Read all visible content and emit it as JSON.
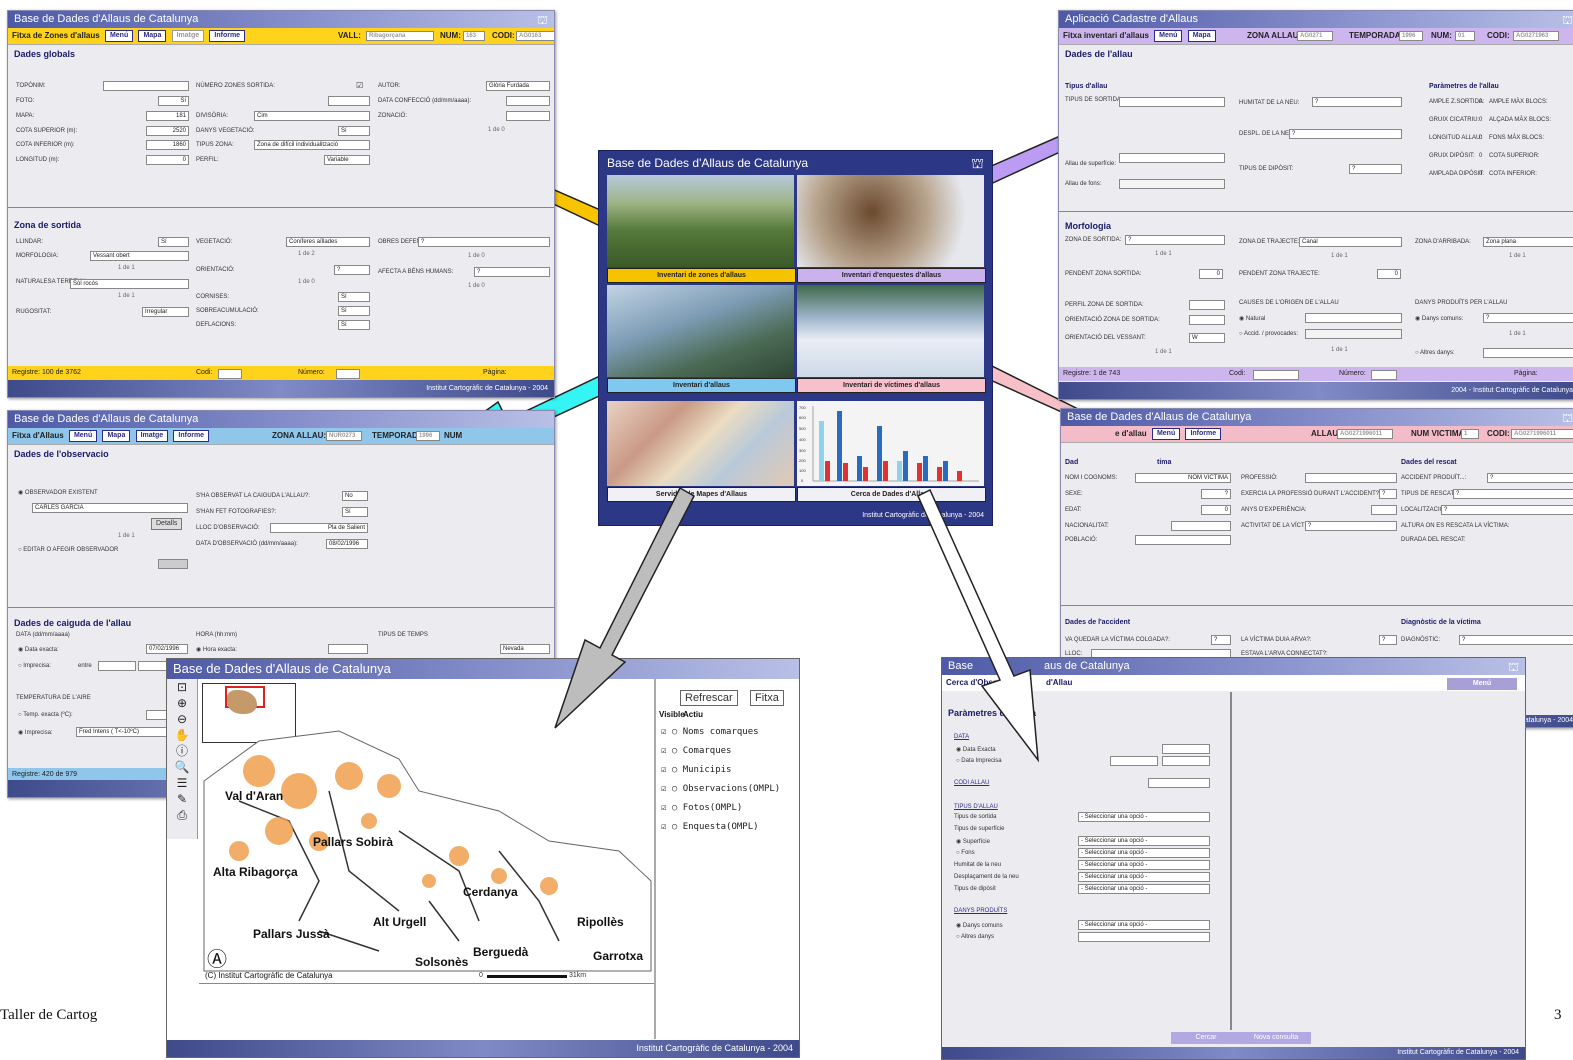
{
  "app_title": "Base de Dades d'Allaus de Catalunya",
  "footer_credit": "Institut Cartogràfic de Catalunya - 2004",
  "footer_credit_alt": "2004 - Institut Cartogràfic de Catalunya",
  "footer_partial": "Catalunya - 2004",
  "slide_footer_left": "Taller de Cartog",
  "slide_page_partial": "3",
  "zones": {
    "form_title": "Fitxa de Zones d'allaus",
    "buttons": [
      "Menú",
      "Mapa",
      "Imatge",
      "Informe"
    ],
    "vall_label": "VALL:",
    "vall_value": "Ribagorçana",
    "num_label": "NUM:",
    "num_value": "163",
    "codi_label": "CODI:",
    "codi_value": "AG0163",
    "section_global": "Dades globals",
    "section_sortida": "Zona de sortida",
    "toponim": "TOPÒNIM:",
    "foto": "FOTO:",
    "foto_v": "Sí",
    "mapa": "MAPA:",
    "mapa_v": "181",
    "cota_sup": "COTA SUPERIOR (m):",
    "cota_sup_v": "2520",
    "cota_inf": "COTA INFERIOR (m):",
    "cota_inf_v": "1860",
    "longitud": "LONGITUD (m):",
    "longitud_v": "0",
    "num_zones": "NÚMERO ZONES SORTIDA:",
    "divisoria": "DIVISÒRIA:",
    "divisoria_v": "Cim",
    "danys": "DANYS VEGETACIÓ:",
    "danys_v": "Sí",
    "tipus_zona": "TIPUS ZONA:",
    "tipus_zona_v": "Zona de difícil individualització",
    "perfil": "PERFIL:",
    "perfil_v": "Variable",
    "autor": "AUTOR:",
    "autor_v": "Glòria Furdada",
    "data": "DATA CONFECCIÓ (dd/mm/aaaa):",
    "zonacio": "ZONACIÓ:",
    "llindar": "LLINDAR:",
    "llindar_v": "Sí",
    "morfologia": "MORFOLOGIA:",
    "morfologia_v": "Vessant obert",
    "naturalesa": "NATURALESA TERRENY:",
    "naturalesa_v": "Sòl rocós",
    "rugositat": "RUGOSITAT:",
    "rugositat_v": "Irregular",
    "vegetacio": "VEGETACIÓ:",
    "vegetacio_v": "Coníferes aïllades",
    "orientacio": "ORIENTACIÓ:",
    "orientacio_v": "?",
    "cornises": "CORNISES:",
    "cornises_v": "Sí",
    "sobreacum": "SOBREACUMULACIÓ:",
    "sobreacum_v": "Sí",
    "deflacions": "DEFLACIONS:",
    "deflacions_v": "Sí",
    "obres": "OBRES DEFENSA:",
    "obres_v": "?",
    "afecta": "AFECTA A BÉNS HUMANS:",
    "afecta_v": "?",
    "nav1": "1 de 1",
    "nav2": "1 de 2",
    "nav0": "1 de 0",
    "registre": "Registre:",
    "registre_v": "100 de 3762",
    "codi": "Codi:",
    "numero": "Número:",
    "pagina": "Pàgina:"
  },
  "cadastre": {
    "window_title": "Aplicació Cadastre d'Allaus",
    "form_title": "Fitxa inventari d'allaus",
    "buttons": [
      "Menú",
      "Mapa"
    ],
    "zona_label": "ZONA ALLAU:",
    "zona_value": "AG0271",
    "temporada_label": "TEMPORADA:",
    "temporada_value": "1996",
    "num_label": "NUM:",
    "num_value": "01",
    "codi_label": "CODI:",
    "codi_value": "AG0271963",
    "section_dades": "Dades de l'allau",
    "tipus": "Tipus d'allau",
    "tipus_sortida": "TIPUS DE SORTIDA:",
    "humitat": "HUMITAT DE LA NEU:",
    "humitat_v": "?",
    "despl": "DESPL. DE LA NEU:",
    "despl_v": "?",
    "tipus_diposit": "TIPUS DE DIPÒSIT:",
    "tipus_diposit_v": "?",
    "allau_sup": "Allau de superfície:",
    "allau_fons": "Allau de fons:",
    "params": "Paràmetres de l'allau",
    "ample_sortida": "AMPLE Z.SORTIDA:",
    "ample_blocs": "AMPLE MÀX BLOCS:",
    "gruix_cicatriu": "GRUIX CICATRIU:",
    "alcada_blocs": "ALÇADA MÀX BLOCS:",
    "longitud_allau": "LONGITUD ALLAU:",
    "fons_blocs": "FONS MÀX BLOCS:",
    "gruix_diposit": "GRUIX DIPÒSIT:",
    "cota_sup": "COTA SUPERIOR:",
    "amplada_diposit": "AMPLADA DIPÒSIT:",
    "cota_inf": "COTA INFERIOR:",
    "zero": "0",
    "section_morf": "Morfologia",
    "zona_sortida": "ZONA DE SORTIDA:",
    "zona_sortida_v": "?",
    "zona_trajecte": "ZONA DE TRAJECTE:",
    "zona_trajecte_v": "Canal",
    "zona_arribada": "ZONA D'ARRIBADA:",
    "zona_arribada_v": "Zona plana",
    "pendent_sortida": "PENDENT ZONA SORTIDA:",
    "pendent_trajecte": "PENDENT ZONA TRAJECTE:",
    "perfil_sortida": "PERFIL ZONA DE SORTIDA:",
    "orient_sortida": "ORIENTACIÓ ZONA DE SORTIDA:",
    "orient_vessant": "ORIENTACIÓ DEL VESSANT:",
    "orient_vessant_v": "W",
    "causes": "CAUSES DE L'ORIGEN DE L'ALLAU",
    "natural": "Natural",
    "accid": "Accid. / provocades:",
    "danys": "DANYS PRODUÏTS PER L'ALLAU",
    "danys_comuns": "Danys comuns:",
    "altres_danys": "Altres danys:",
    "nav": "1 de 1",
    "registre": "Registre:",
    "registre_v": "1 de 743",
    "codi": "Codi:",
    "numero": "Número:",
    "pagina": "Pàgina:"
  },
  "portal": {
    "tiles": [
      "Inventari de zones d'allaus",
      "Inventari d'enquestes d'allaus",
      "Inventari d'allaus",
      "Inventari de víctimes d'allaus",
      "Servidor de Mapes d'Allaus",
      "Cerca de Dades d'Allaus"
    ],
    "chart_axis": [
      "700",
      "600",
      "500",
      "400",
      "300",
      "200",
      "100",
      "0"
    ]
  },
  "observ": {
    "form_title": "Fitxa d'Allaus",
    "buttons": [
      "Menú",
      "Mapa",
      "Imatge",
      "Informe"
    ],
    "zona_label": "ZONA ALLAU:",
    "zona_value": "NUR0273",
    "temporada_label": "TEMPORADA:",
    "temporada_value": "1996",
    "num_label": "NUM",
    "section_obs": "Dades de l'observacio",
    "obs_existent": "OBSERVADOR EXISTENT",
    "obs_value": "CARLES GARCIA",
    "detalls": "Detalls",
    "editar": "EDITAR O AFEGIR OBSERVADOR",
    "nav": "1 de 1",
    "caiguda": "S'HA OBSERVAT LA CAIGUDA L'ALLAU?:",
    "caiguda_v": "No",
    "foto": "S'HAN FET FOTOGRAFIES?:",
    "foto_v": "Sí",
    "lloc": "LLOC D'OBSERVACIÓ:",
    "lloc_v": "Pla de Salient",
    "data": "DATA D'OBSERVACIÓ (dd/mm/aaaa):",
    "data_v": "08/02/1996",
    "section_caig": "Dades de caiguda de l'allau",
    "data_c": "DATA (dd/mm/aaaa)",
    "data_exacta": "Data exacta:",
    "data_exacta_v": "07/02/1996",
    "imprecisa": "Imprecisa:",
    "entre": "entre",
    "hora": "HORA (hh:mm)",
    "hora_exacta": "Hora exacta:",
    "temps": "TIPUS DE TEMPS",
    "temps_v": "Nevada",
    "temp": "TEMPERATURA DE L'AIRE",
    "temp_exacta": "Temp. exacta (ºC):",
    "temp_imprecisa": "Imprecisa:",
    "temp_v": "Fred Intens ( T<-10ºC)",
    "registre": "Registre:",
    "registre_v": "420 de 979"
  },
  "victimes": {
    "form_title": "Fitxa de víctimes d'allau",
    "form_title_visible": "e d'allau",
    "buttons": [
      "Menú",
      "Informe"
    ],
    "allau_label": "ALLAU:",
    "allau_value": "AG0271996011",
    "num_label": "NUM VICTIMA:",
    "num_value": "1",
    "codi_label": "CODI:",
    "codi_value": "AG0271996011",
    "dades_vic": "Dades de la víctima",
    "dades_vic_visible": "Dad",
    "dades_vic_tail": "tima",
    "nom": "NOM I COGNOMS:",
    "nom_v": "NOM VICTIMA",
    "sexe": "SEXE:",
    "sexe_v": "?",
    "edat": "EDAT:",
    "edat_v": "0",
    "nac": "NACIONALITAT:",
    "poblacio": "POBLACIÓ:",
    "professio": "PROFESSIÓ:",
    "exercia": "EXERCIA LA PROFESSIÓ DURANT L'ACCIDENT?:",
    "exercia_v": "?",
    "anys": "ANYS D'EXPERIÈNCIA:",
    "activitat": "ACTIVITAT DE LA VÍCTIMA:",
    "activitat_v": "?",
    "dades_rescat": "Dades del rescat",
    "accident": "ACCIDENT PRODUÏT...:",
    "accident_v": "?",
    "tipus_rescat": "TIPUS DE RESCAT:",
    "tipus_rescat_v": "?",
    "localitzacio": "LOCALITZACIÓ:",
    "localitzacio_v": "?",
    "altura": "ALTURA ON ES RESCATA LA VÍCTIMA:",
    "durada": "DURADA DEL RESCAT:",
    "dades_acc": "Dades de l'accident",
    "quedar": "VA QUEDAR LA VÍCTIMA COLGADA?:",
    "quedar_v": "?",
    "lloc": "LLOC:",
    "arvaa": "LA VÍCTIMA DUIA ARVA?:",
    "arvaa_v": "?",
    "connectat": "ESTAVA L'ARVA CONNECTAT?:",
    "diagnostic": "Diagnòstic de la víctima",
    "diag": "DIAGNÒSTIC:",
    "diag_v": "?"
  },
  "map": {
    "buttons": [
      "Refrescar",
      "Fitxa"
    ],
    "legend_head_visible": "Visible",
    "legend_head_active": "Actiu",
    "layers": [
      "Noms comarques",
      "Comarques",
      "Municipis",
      "Observacions(OMPL)",
      "Fotos(OMPL)",
      "Enquesta(OMPL)"
    ],
    "labels": [
      "Val d'Aran",
      "Pallars Sobirà",
      "Alta Ribagorça",
      "Cerdanya",
      "Alt Urgell",
      "Pallars Jussà",
      "Ripollès",
      "Berguedà",
      "Garrotxa",
      "Solsonès"
    ],
    "copyright": "(C) Institut Cartogràfic de Catalunya",
    "scale_start": "0",
    "scale_end": "31km"
  },
  "search": {
    "form_title": "Cerca d'Observacions d'Allau",
    "form_title_left": "Cerca d'Obser",
    "form_title_right": "d'Allau",
    "title_left": "Base",
    "title_right": "aus de Catalunya",
    "menu": "Menú",
    "params": "Paràmetres de cerca",
    "data": "DATA",
    "data_exacta": "Data Exacta",
    "data_imprecisa": "Data Imprecisa",
    "codi": "CODI ALLAU",
    "tipus_allau": "TIPUS D'ALLAU",
    "tipus_sortida": "Tipus de sortida",
    "tipus_sup": "Tipus de superfície",
    "superficie": "Superfície",
    "fons": "Fons",
    "humitat": "Humitat de la neu",
    "despl": "Desplaçament de la neu",
    "diposit": "Tipus de dipòsit",
    "danys": "DANYS PRODUÏTS",
    "danys_comuns": "Danys comuns",
    "altres": "Altres danys",
    "select": "- Seleccionar una opció -",
    "cercar": "Cercar",
    "nova": "Nova consulta"
  }
}
